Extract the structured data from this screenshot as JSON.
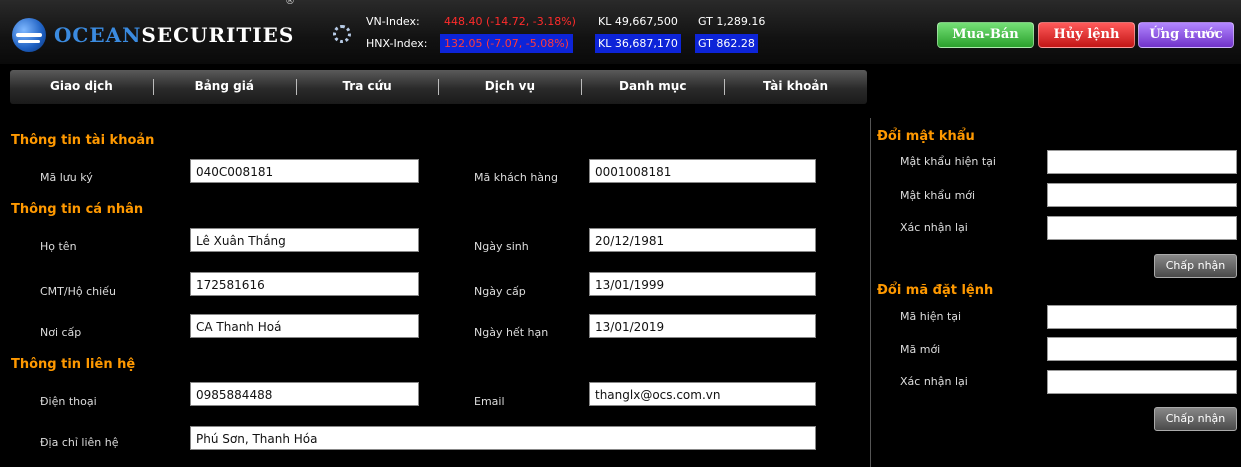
{
  "header": {
    "logo": {
      "ocean": "OCEAN",
      "securities": "SECURITIES",
      "reg": "®"
    },
    "indices": [
      {
        "name": "VN-Index:",
        "value": "448.40 (-14.72, -3.18%)",
        "kl_label": "KL",
        "kl": "49,667,500",
        "gt_label": "GT",
        "gt": "1,289.16"
      },
      {
        "name": "HNX-Index:",
        "value": "132.05 (-7.07, -5.08%)",
        "kl_label": "KL",
        "kl": "36,687,170",
        "gt_label": "GT",
        "gt": "862.28"
      }
    ],
    "buttons": {
      "trade": "Mua-Bán",
      "cancel": "Hủy lệnh",
      "advance": "Ứng trước"
    },
    "colors": {
      "trade": "#2aa02c",
      "cancel": "#c21515",
      "advance": "#7032c9",
      "down": "#ff2b2b",
      "highlight": "#0d24d8"
    }
  },
  "nav": [
    "Giao dịch",
    "Bảng giá",
    "Tra cứu",
    "Dịch vụ",
    "Danh mục",
    "Tài khoản"
  ],
  "account": {
    "title": "Thông tin tài khoản",
    "custody_label": "Mã lưu ký",
    "custody": "040C008181",
    "customer_label": "Mã khách hàng",
    "customer": "0001008181"
  },
  "personal": {
    "title": "Thông tin cá nhân",
    "name_label": "Họ tên",
    "name": "Lê Xuân Thắng",
    "dob_label": "Ngày sinh",
    "dob": "20/12/1981",
    "id_label": "CMT/Hộ chiếu",
    "id": "172581616",
    "issue_date_label": "Ngày cấp",
    "issue_date": "13/01/1999",
    "issue_place_label": "Nơi cấp",
    "issue_place": "CA Thanh Hoá",
    "expiry_label": "Ngày hết hạn",
    "expiry": "13/01/2019"
  },
  "contact": {
    "title": "Thông tin liên hệ",
    "phone_label": "Điện thoại",
    "phone": "0985884488",
    "email_label": "Email",
    "email": "thanglx@ocs.com.vn",
    "address_label": "Địa chỉ liên hệ",
    "address": "Phú Sơn, Thanh Hóa"
  },
  "password": {
    "title": "Đổi mật khẩu",
    "current_label": "Mật khẩu hiện tại",
    "new_label": "Mật khẩu mới",
    "confirm_label": "Xác nhận lại",
    "submit": "Chấp nhận"
  },
  "order_code": {
    "title": "Đổi mã đặt lệnh",
    "current_label": "Mã hiện tại",
    "new_label": "Mã mới",
    "confirm_label": "Xác nhận lại",
    "submit": "Chấp nhận"
  }
}
